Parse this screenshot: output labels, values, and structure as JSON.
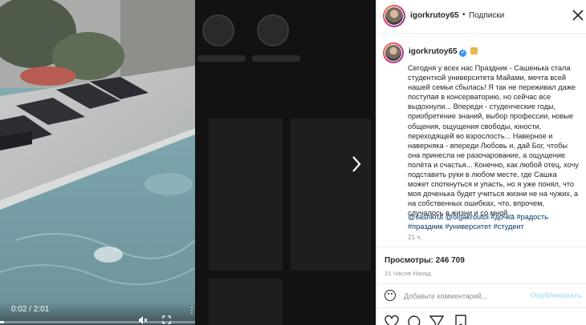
{
  "video": {
    "time": "0:02 / 2:01",
    "progress": 0.02,
    "mute_icon": "muted-speaker-icon",
    "fullscreen_icon": "fullscreen-icon",
    "more_icon": "vertical-dots-icon"
  },
  "navigation": {
    "next_icon": "chevron-right-icon"
  },
  "header": {
    "username": "igorkrutoy65",
    "separator": "•",
    "follow_status": "Подписки",
    "close_icon": "close-icon"
  },
  "caption": {
    "username": "igorkrutoy65",
    "text": "Сегодня у всех нас Праздник - Сашенька стала студенткой университета Майами, мечта всей нашей семьи сбылась! Я так не переживал даже поступая в консерваторию, но сейчас все выдохнули... Впереди - студенческие годы, приобретение знаний, выбор профессии, новые общения, ощущения свободы, юности, переходящей во взрослость... Наверное и наверняка - впереди Любовь и, дай Бог, чтобы она принесла не разочарование, а ощущение полёта и счастья... Конечно, как любой отец, хочу подставить руки в любом месте, где Сашка может споткнуться и упасть, но я уже понял, что моя доченька будет учиться жизни не на чужих, а на собственных ошибках, что, впрочем, случалось в жизни и со мной...",
    "mentions": "@sashkrut @olgakroutoi #дочка #радость #праздник #университет #студент",
    "posted_ago": "21 ч."
  },
  "stats": {
    "views_label": "Просмотры:",
    "views_count": "246 709",
    "timestamp": "21 Часов Назад"
  },
  "comment": {
    "placeholder": "Добавьте комментарий...",
    "publish_label": "Опубликовать"
  },
  "colors": {
    "accent": "#3897f0",
    "link": "#00376b",
    "publish_disabled": "#b2dffc"
  }
}
